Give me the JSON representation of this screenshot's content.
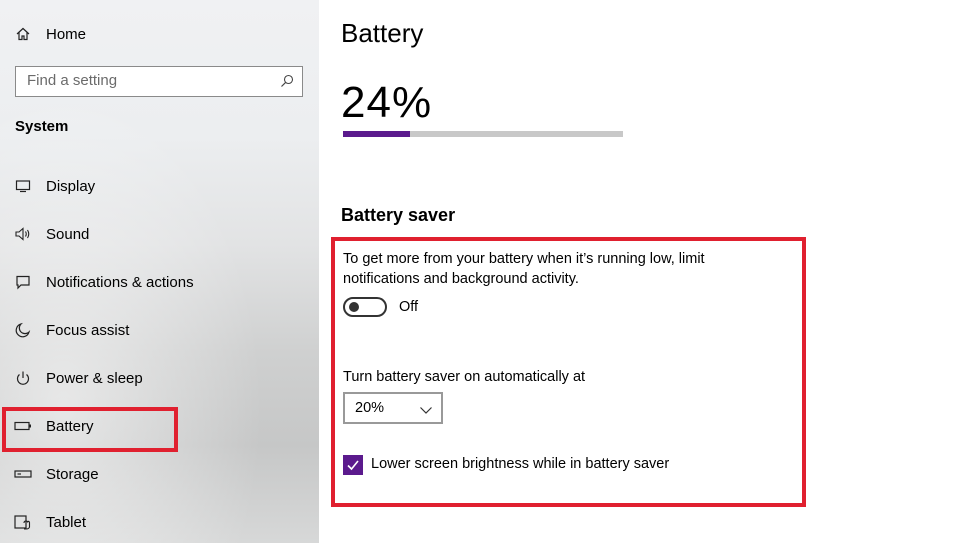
{
  "sidebar": {
    "home_label": "Home",
    "search_placeholder": "Find a setting",
    "section_title": "System",
    "items": [
      {
        "label": "Display",
        "icon": "display-icon"
      },
      {
        "label": "Sound",
        "icon": "speaker-icon"
      },
      {
        "label": "Notifications & actions",
        "icon": "notification-icon"
      },
      {
        "label": "Focus assist",
        "icon": "moon-icon"
      },
      {
        "label": "Power & sleep",
        "icon": "power-icon"
      },
      {
        "label": "Battery",
        "icon": "battery-icon",
        "selected": true
      },
      {
        "label": "Storage",
        "icon": "storage-icon"
      },
      {
        "label": "Tablet",
        "icon": "tablet-icon"
      }
    ]
  },
  "main": {
    "title": "Battery",
    "battery_percent": "24%",
    "battery_level": 0.24,
    "battery_saver": {
      "heading": "Battery saver",
      "description": "To get more from your battery when it’s running low, limit notifications and background activity.",
      "toggle_state": "Off",
      "auto_label": "Turn battery saver on automatically at",
      "threshold": "20%",
      "brightness_label": "Lower screen brightness while in battery saver",
      "brightness_checked": true
    }
  },
  "colors": {
    "accent": "#5b1a8d",
    "highlight_border": "#e0202f",
    "bar_track": "#c8c8c8"
  }
}
